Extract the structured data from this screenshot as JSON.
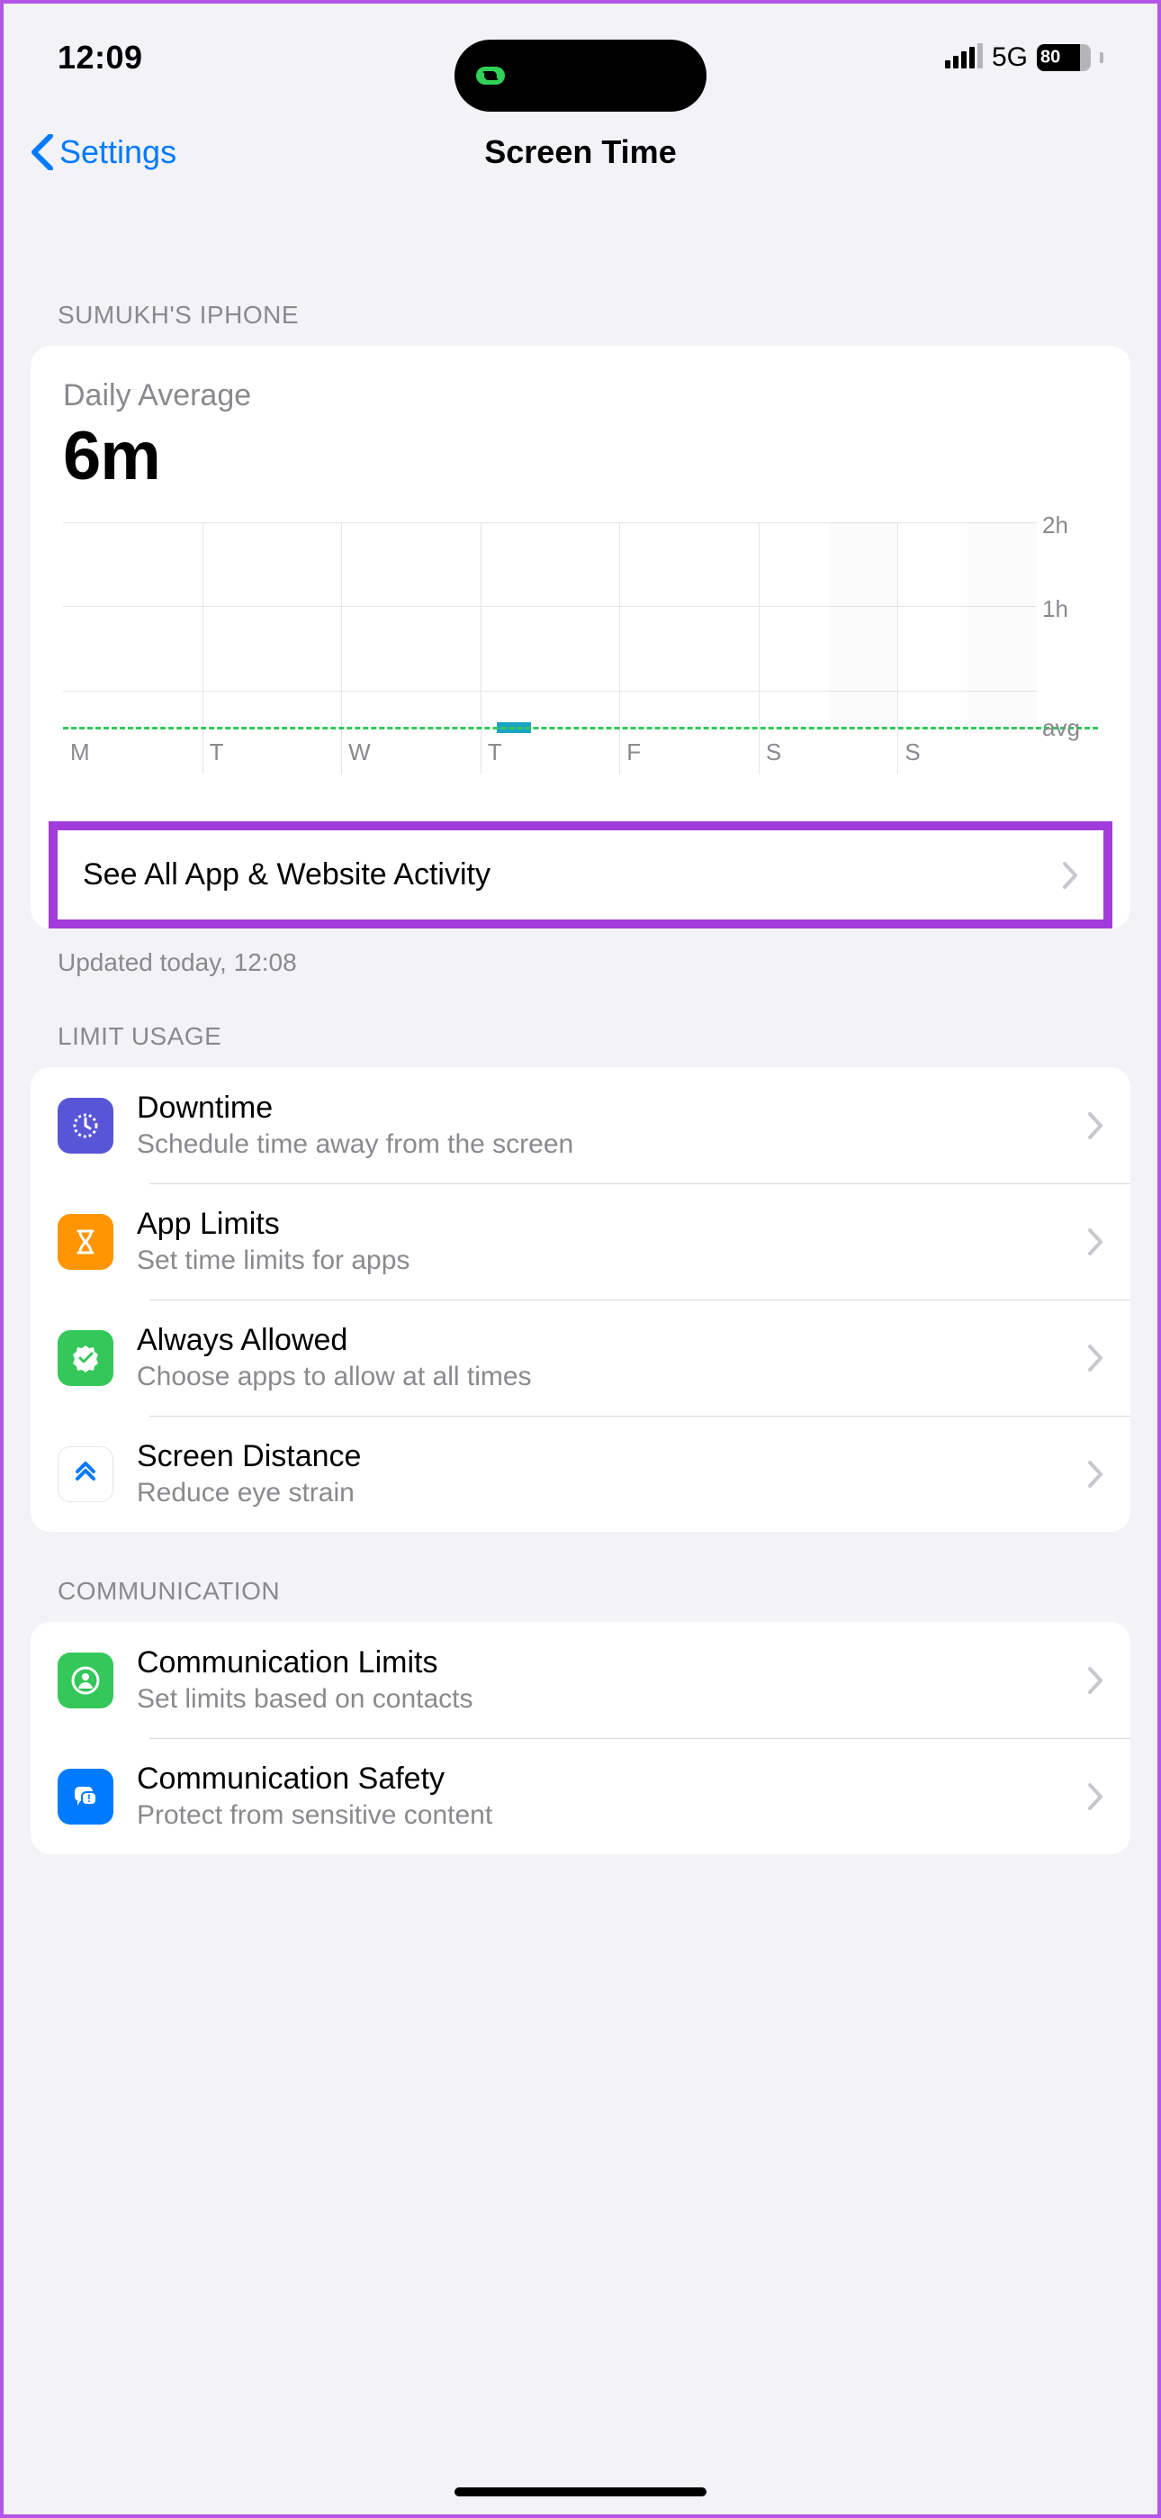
{
  "status": {
    "time": "12:09",
    "network": "5G",
    "battery": "80"
  },
  "nav": {
    "back": "Settings",
    "title": "Screen Time"
  },
  "sections": {
    "device": "SUMUKH'S IPHONE",
    "limit": "LIMIT USAGE",
    "communication": "COMMUNICATION"
  },
  "summary": {
    "label": "Daily Average",
    "value": "6m",
    "see_all": "See All App & Website Activity",
    "updated": "Updated today, 12:08"
  },
  "chart_data": {
    "type": "bar",
    "categories": [
      "M",
      "T",
      "W",
      "T",
      "F",
      "S",
      "S"
    ],
    "values": [
      0,
      0,
      0,
      6,
      0,
      0,
      0
    ],
    "unit": "minutes",
    "ylabel_ticks": [
      "2h",
      "1h"
    ],
    "ylim": [
      0,
      120
    ],
    "avg_label": "avg",
    "avg_value": 6
  },
  "limit_rows": [
    {
      "title": "Downtime",
      "sub": "Schedule time away from the screen"
    },
    {
      "title": "App Limits",
      "sub": "Set time limits for apps"
    },
    {
      "title": "Always Allowed",
      "sub": "Choose apps to allow at all times"
    },
    {
      "title": "Screen Distance",
      "sub": "Reduce eye strain"
    }
  ],
  "comm_rows": [
    {
      "title": "Communication Limits",
      "sub": "Set limits based on contacts"
    },
    {
      "title": "Communication Safety",
      "sub": "Protect from sensitive content"
    }
  ]
}
